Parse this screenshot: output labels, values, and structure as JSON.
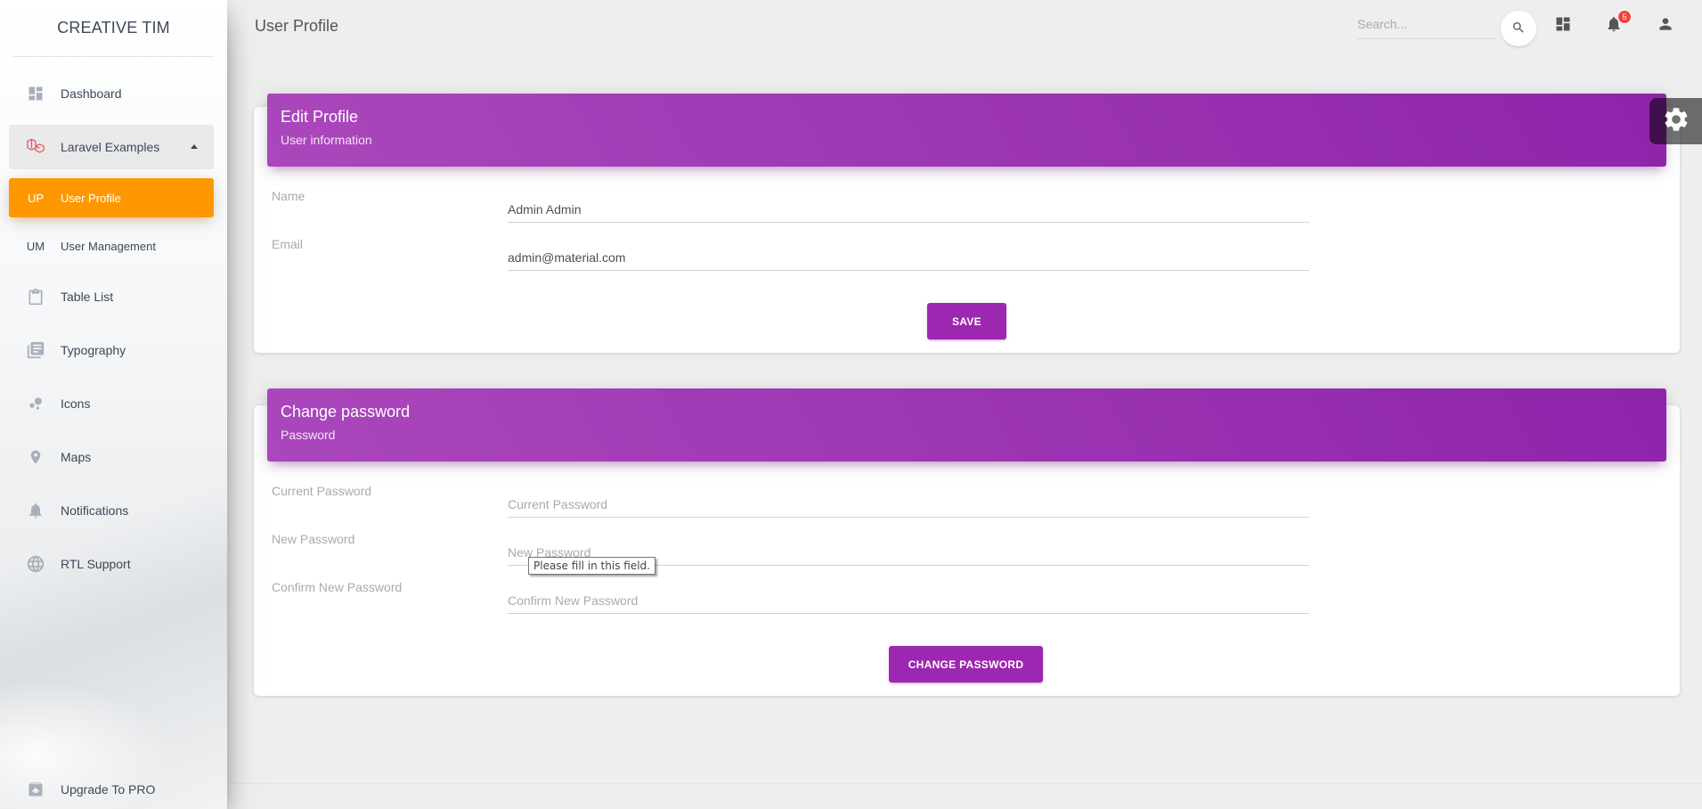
{
  "brand": "CREATIVE TIM",
  "sidebar": {
    "items": [
      {
        "label": "Dashboard",
        "icon": "dashboard-icon"
      },
      {
        "label": "Laravel Examples",
        "icon": "laravel-icon"
      },
      {
        "abbr": "UP",
        "label": "User Profile"
      },
      {
        "abbr": "UM",
        "label": "User Management"
      },
      {
        "label": "Table List",
        "icon": "clipboard-icon"
      },
      {
        "label": "Typography",
        "icon": "library-books-icon"
      },
      {
        "label": "Icons",
        "icon": "bubble-chart-icon"
      },
      {
        "label": "Maps",
        "icon": "location-pin-icon"
      },
      {
        "label": "Notifications",
        "icon": "bell-icon"
      },
      {
        "label": "RTL Support",
        "icon": "language-icon"
      }
    ],
    "upgrade": "Upgrade To PRO"
  },
  "header": {
    "title": "User Profile",
    "search_placeholder": "Search...",
    "notifications_count": "5"
  },
  "profile_card": {
    "title": "Edit Profile",
    "subtitle": "User information",
    "name_label": "Name",
    "name_value": "Admin Admin",
    "email_label": "Email",
    "email_value": "admin@material.com",
    "save_label": "SAVE"
  },
  "password_card": {
    "title": "Change password",
    "subtitle": "Password",
    "current_label": "Current Password",
    "current_placeholder": "Current Password",
    "new_label": "New Password",
    "new_placeholder": "New Password",
    "confirm_label": "Confirm New Password",
    "confirm_placeholder": "Confirm New Password",
    "submit_label": "CHANGE PASSWORD"
  },
  "tooltip": "Please fill in this field.",
  "colors": {
    "primary": "#9c27b0",
    "active_nav": "#ff9800",
    "badge": "#f44336"
  }
}
